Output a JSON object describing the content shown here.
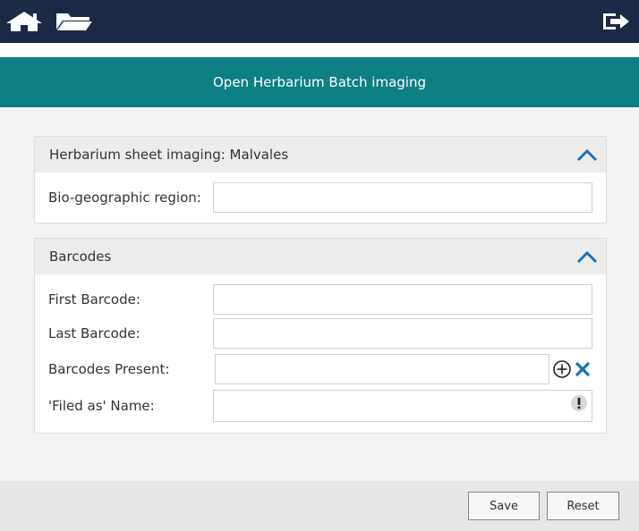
{
  "header": {
    "home_icon": "home-icon",
    "folder_icon": "folder-open-icon",
    "logout_icon": "logout-icon",
    "background": "#1b2944"
  },
  "title": {
    "text": "Open Herbarium Batch imaging",
    "background": "#0e7f82"
  },
  "panel_sheet": {
    "title": "Herbarium sheet imaging: Malvales",
    "fields": {
      "region_label": "Bio-geographic region:",
      "region_value": ""
    }
  },
  "panel_barcodes": {
    "title": "Barcodes",
    "fields": {
      "first_label": "First Barcode:",
      "first_value": "",
      "last_label": "Last Barcode:",
      "last_value": "",
      "present_label": "Barcodes Present:",
      "present_value": "",
      "filed_label": "'Filed as' Name:",
      "filed_value": ""
    }
  },
  "footer": {
    "save_label": "Save",
    "reset_label": "Reset"
  },
  "colors": {
    "accent": "#1a73b8",
    "panel_header": "#ececec"
  }
}
